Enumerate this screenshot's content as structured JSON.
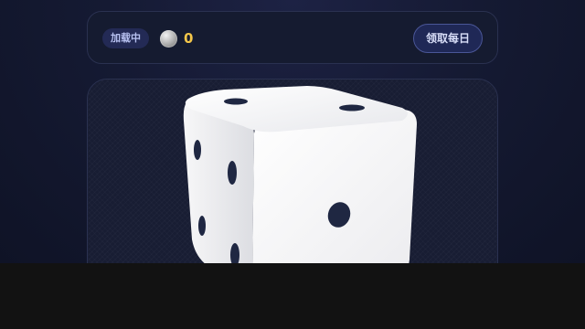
{
  "header": {
    "status_label": "加载中",
    "coin_icon": "silver-coin-icon",
    "coin_count": "0",
    "claim_button_label": "领取每日"
  },
  "die": {
    "top_face_pips": 2,
    "left_face_pips": 4,
    "right_face_pips": 1,
    "face_color": "#f4f4f5",
    "pip_color": "#1f2742"
  },
  "colors": {
    "coin_count": "#f3c64a",
    "panel_background": "#151b30",
    "page_background": "#151a33"
  }
}
